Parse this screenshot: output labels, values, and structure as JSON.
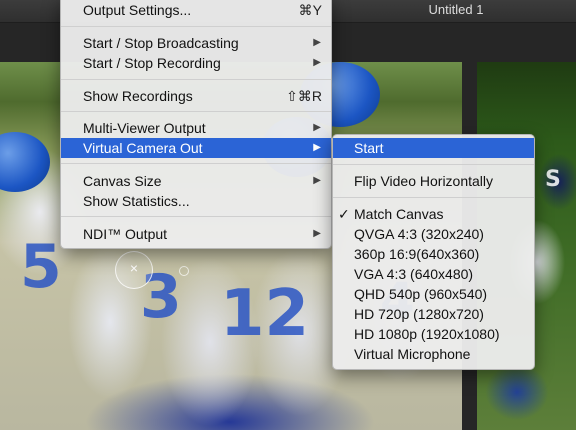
{
  "window": {
    "title": "Untitled 1"
  },
  "main_menu": {
    "output_settings": {
      "label": "Output Settings...",
      "shortcut": "⌘Y"
    },
    "start_stop_broadcasting": {
      "label": "Start / Stop Broadcasting"
    },
    "start_stop_recording": {
      "label": "Start / Stop Recording"
    },
    "show_recordings": {
      "label": "Show Recordings",
      "shortcut": "⇧⌘R"
    },
    "multi_viewer_output": {
      "label": "Multi-Viewer Output"
    },
    "virtual_camera_out": {
      "label": "Virtual Camera Out"
    },
    "canvas_size": {
      "label": "Canvas Size"
    },
    "show_statistics": {
      "label": "Show Statistics..."
    },
    "ndi_output": {
      "label": "NDI™ Output"
    },
    "submenu_arrow": "▶"
  },
  "submenu": {
    "start": "Start",
    "flip_video": "Flip Video Horizontally",
    "check_mark": "✓",
    "resolutions": [
      "Match Canvas",
      "QVGA 4:3 (320x240)",
      "360p 16:9(640x360)",
      "VGA 4:3 (640x480)",
      "QHD 540p (960x540)",
      "HD 720p (1280x720)",
      "HD 1080p (1920x1080)"
    ],
    "virtual_microphone": "Virtual Microphone"
  },
  "canvas": {
    "crosshair_glyph": "×"
  },
  "colors": {
    "highlight": "#2b64d6",
    "menu_bg": "#ececec"
  }
}
